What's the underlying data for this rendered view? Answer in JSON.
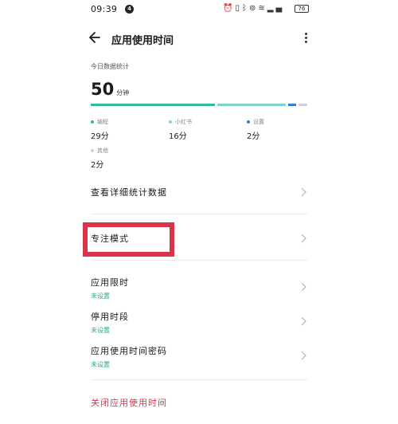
{
  "status_bar": {
    "time": "09:39",
    "notification_badge": "4",
    "icons": [
      "alarm-icon",
      "vibrate-icon",
      "bluetooth-icon",
      "hotspot-icon",
      "wifi-icon",
      "signal-icon",
      "signal-icon",
      "battery-icon"
    ],
    "battery": "76"
  },
  "header": {
    "title": "应用使用时间"
  },
  "summary": {
    "label": "今日数据统计",
    "total_value": "50",
    "total_unit": "分钟"
  },
  "usage_bar": [
    {
      "name": "编程",
      "minutes": 29,
      "color": "#32b89a"
    },
    {
      "name": "小红书",
      "minutes": 16,
      "color": "#7fd3d3"
    },
    {
      "name": "设置",
      "minutes": 2,
      "color": "#2b7fd6"
    },
    {
      "name": "其他",
      "minutes": 2,
      "color": "#cfd3d7"
    }
  ],
  "categories": [
    {
      "name": "编程",
      "value": "29分",
      "color": "#32b89a"
    },
    {
      "name": "小红书",
      "value": "16分",
      "color": "#7fd3d3"
    },
    {
      "name": "设置",
      "value": "2分",
      "color": "#2b7fd6"
    },
    {
      "name": "其他",
      "value": "2分",
      "color": "#cfd3d7"
    }
  ],
  "menu": {
    "detail": "查看详细统计数据",
    "focus_mode": "专注模式",
    "app_limit": "应用限时",
    "app_limit_status": "未设置",
    "downtime": "停用时段",
    "downtime_status": "未设置",
    "passcode": "应用使用时间密码",
    "passcode_status": "未设置"
  },
  "close_link": "关闭应用使用时间",
  "colors": {
    "accent_green": "#2aa88e",
    "highlight_red": "#d9344a"
  }
}
